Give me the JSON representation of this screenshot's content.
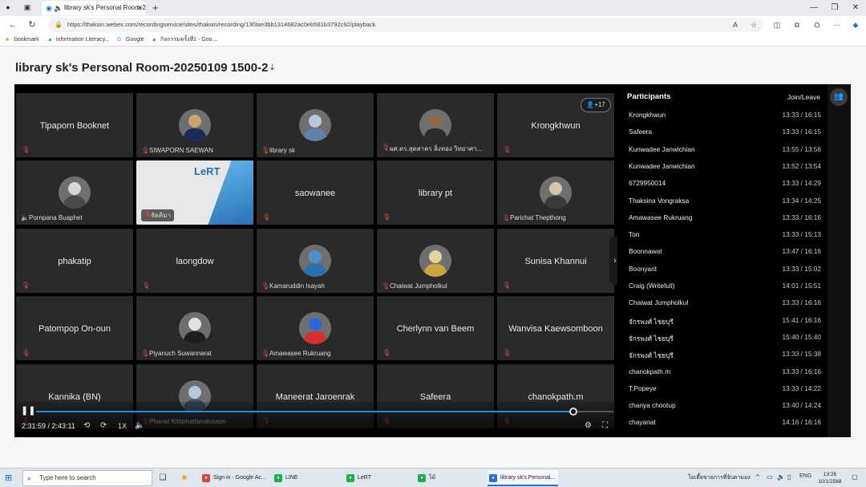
{
  "browser": {
    "tab_title": "library sk's Personal Room-2...",
    "url": "https://thaksin.webex.com/recordingservice/sites/thaksin/recording/13f3ae3bb1314682ac0eb581b3792c92/playback",
    "bookmarks": [
      "bookmark",
      "information Literacy...",
      "Google",
      "กิจกรรมครั้งที่1 - Goo..."
    ]
  },
  "page": {
    "title": "library sk's Personal Room-20250109 1500-2"
  },
  "grid": {
    "more_badge": "+17",
    "tiles": [
      {
        "name": "Tipaporn Booknet",
        "type": "text"
      },
      {
        "name": "SIWAPORN SAEWAN",
        "type": "avatar",
        "color": "#c9a46a",
        "body": "#1c2a5a"
      },
      {
        "name": "library sk",
        "type": "avatar",
        "color": "#b9c8d8",
        "body": "#5e82a8"
      },
      {
        "name": "ผศ.ดร.สุดสาคร ลิ่งทอง วิทยาศา...",
        "type": "avatar",
        "color": "#8d6a45",
        "body": "#2c2c2c"
      },
      {
        "name": "Krongkhwun",
        "type": "text"
      },
      {
        "name": "Pornpana Buaphet",
        "type": "avatar",
        "color": "#d6d6d6",
        "body": "#4a4a4a",
        "speaker": true
      },
      {
        "name": "จัดคิมา",
        "type": "shared",
        "logo": "LeRT"
      },
      {
        "name": "saowanee",
        "type": "text"
      },
      {
        "name": "library pt",
        "type": "text"
      },
      {
        "name": "Parichat Thepthong",
        "type": "avatar",
        "color": "#d8c6a8",
        "body": "#3a3a3a"
      },
      {
        "name": "phakatip",
        "type": "text"
      },
      {
        "name": "laongdow",
        "type": "text"
      },
      {
        "name": "Kamaruddin Isayah",
        "type": "avatar",
        "color": "#4a8fd0",
        "body": "#2a6fb0"
      },
      {
        "name": "Chaiwat Jumpholkul",
        "type": "avatar",
        "color": "#e6d39a",
        "body": "#c9a540"
      },
      {
        "name": "Sunisa Khannui",
        "type": "text"
      },
      {
        "name": "Patompop On-oun",
        "type": "text"
      },
      {
        "name": "Piyanuch Suwannarat",
        "type": "avatar",
        "color": "#e2e2e2",
        "body": "#1e1e1e"
      },
      {
        "name": "Amawasee Rukruang",
        "type": "avatar",
        "color": "#2a6ad8",
        "body": "#d83030"
      },
      {
        "name": "Cherlynn van Beem",
        "type": "text"
      },
      {
        "name": "Wanvisa Kaewsomboon",
        "type": "text"
      },
      {
        "name": "Kannika (BN)",
        "type": "text"
      },
      {
        "name": "Phanat Kittiphattanabawon",
        "type": "avatar",
        "color": "#b8c8d8",
        "body": "#3a4a5a"
      },
      {
        "name": "Maneerat Jaroenrak",
        "type": "text"
      },
      {
        "name": "Safeera",
        "type": "text"
      },
      {
        "name": "chanokpath.m",
        "type": "text"
      }
    ]
  },
  "playback": {
    "time": "2:31:59 / 2:43:11",
    "speed": "1X",
    "progress": 0.93
  },
  "participants": {
    "header": "Participants",
    "column": "Join/Leave",
    "rows": [
      {
        "name": "Krongkhwun",
        "time": "13:33 / 16:15"
      },
      {
        "name": "Safeera",
        "time": "13:33 / 16:15"
      },
      {
        "name": "Kunwadee Janwichian",
        "time": "13:55 / 13:56"
      },
      {
        "name": "Kunwadee Janwichian",
        "time": "13:52 / 13:54"
      },
      {
        "name": "6729950014",
        "time": "13:33 / 14:29"
      },
      {
        "name": "Thaksina Vongraksa",
        "time": "13:34 / 14:25"
      },
      {
        "name": "Amawasee Rukruang",
        "time": "13:33 / 16:16"
      },
      {
        "name": "Ton",
        "time": "13:33 / 15:13"
      },
      {
        "name": "Boonnawat",
        "time": "13:47 / 16:16"
      },
      {
        "name": "Boonyarit",
        "time": "13:33 / 15:02"
      },
      {
        "name": "Craig (Writefull)",
        "time": "14:01 / 15:51"
      },
      {
        "name": "Chaiwat Jumpholkul",
        "time": "13:33 / 16:16"
      },
      {
        "name": "จักรพงศ์ ไชยบุรี",
        "time": "15:41 / 16:16"
      },
      {
        "name": "จักรพงศ์ ไชยบุรี",
        "time": "15:40 / 15:40"
      },
      {
        "name": "จักรพงศ์ ไชยบุรี",
        "time": "13:33 / 15:38"
      },
      {
        "name": "chanokpath.m",
        "time": "13:33 / 16:16"
      },
      {
        "name": "T.Popeye",
        "time": "13:33 / 14:22"
      },
      {
        "name": "chanya chootup",
        "time": "13:40 / 14:24"
      },
      {
        "name": "chayanat",
        "time": "14:16 / 16:16"
      }
    ]
  },
  "taskbar": {
    "search_placeholder": "Type here to search",
    "apps": [
      {
        "label": "Sign in - Google Ac...",
        "color": "#d9453a"
      },
      {
        "label": "LINE",
        "color": "#19b24a"
      },
      {
        "label": "LeRT",
        "color": "#19b24a"
      },
      {
        "label": "ไม้",
        "color": "#19b24a"
      },
      {
        "label": "library sk's Personal...",
        "color": "#1a73e8",
        "active": true
      }
    ],
    "tray_text": "โอเตี้ยขายการที่จับตามอง",
    "lang": "ENG",
    "time": "13:26",
    "date": "10/1/2568"
  }
}
